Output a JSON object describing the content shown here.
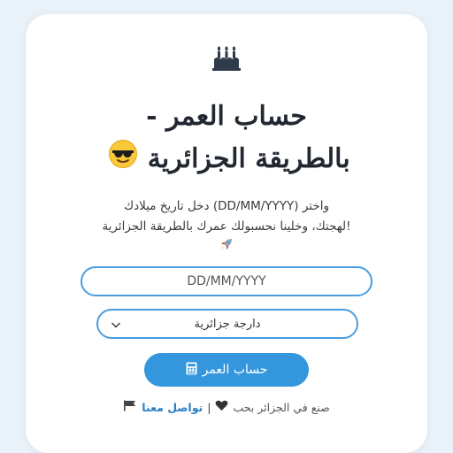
{
  "header": {
    "logo_icon": "birthday-cake-icon",
    "title_line1": "حساب العمر -",
    "title_line2": "بالطريقة الجزائرية",
    "title_emoji": "sunglasses-face-emoji"
  },
  "description": {
    "line1": "واختر (DD/MM/YYYY) دخل تاريخ ميلادك",
    "line2": "!لهجتك، وخلينا نحسبولك عمرك بالطريقة الجزائرية",
    "rocket_icon": "rocket-icon"
  },
  "form": {
    "date_placeholder": "DD/MM/YYYY",
    "date_value": "",
    "dialect_selected": "دارجة جزائرية",
    "calculate_label": "حساب العمر",
    "calculate_icon": "calculator-icon"
  },
  "footer": {
    "made_text": "صنع في الجزائر بحب",
    "heart_icon": "heart-icon",
    "separator": "|",
    "contact_label": "تواصل معنا",
    "flag_icon": "flag-icon"
  },
  "colors": {
    "accent": "#3496dc",
    "border": "#4a9ee0",
    "link": "#2a7fc4",
    "title": "#222831"
  }
}
